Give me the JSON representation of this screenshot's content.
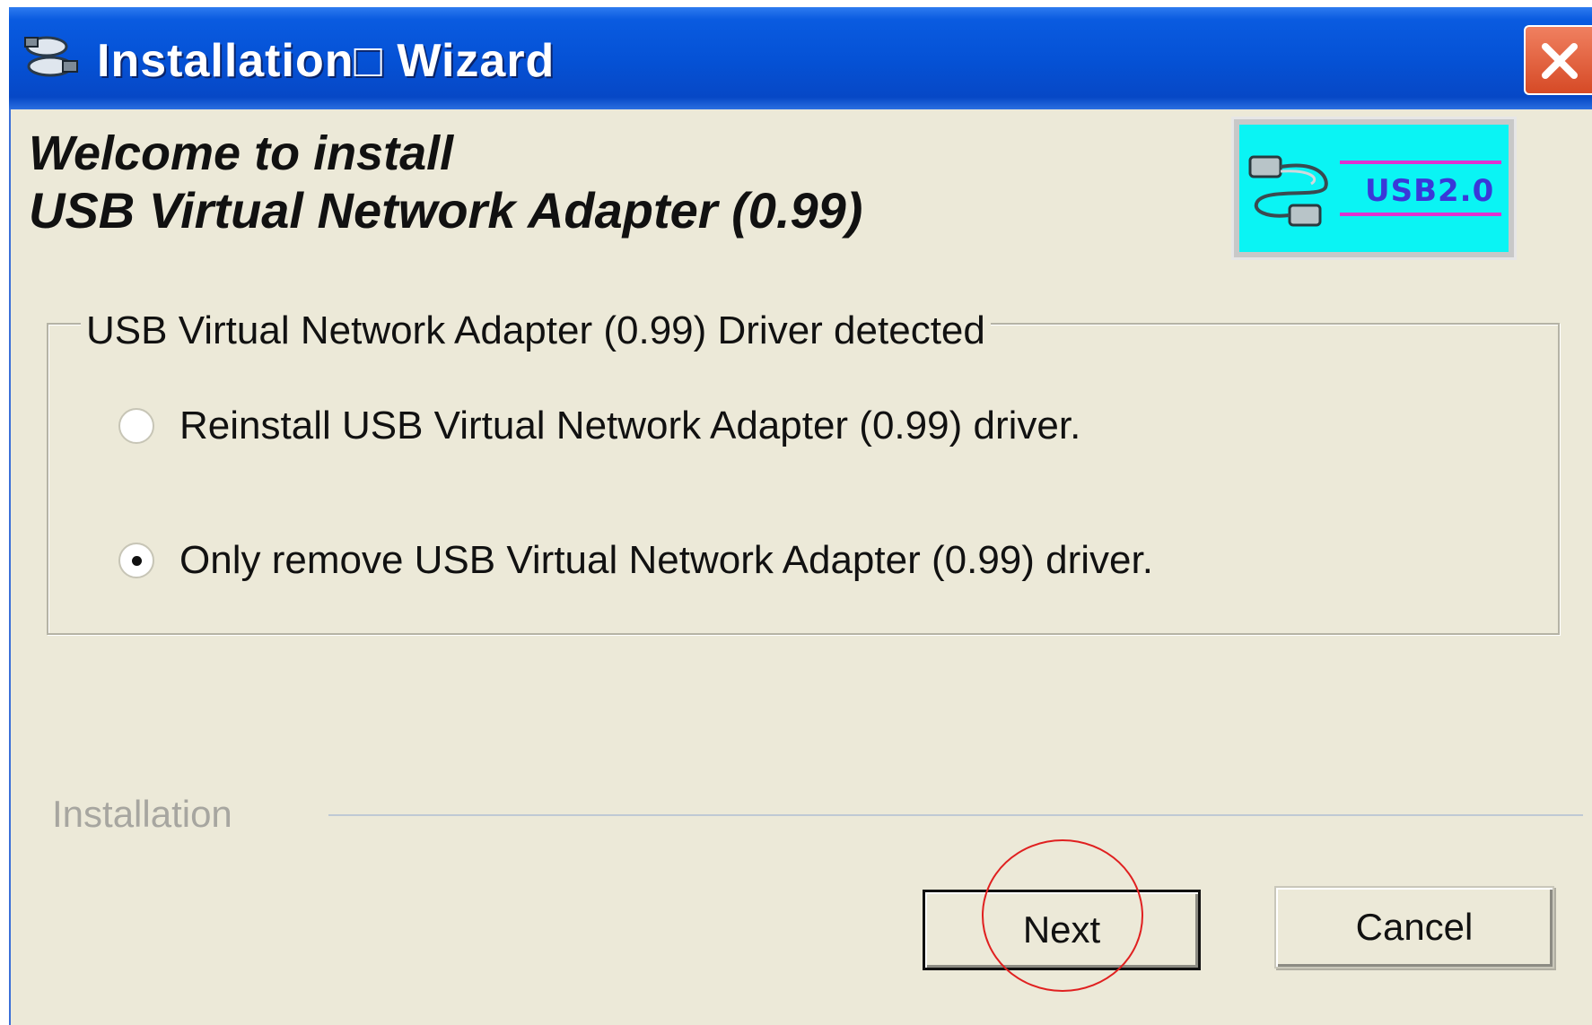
{
  "window": {
    "title": "Installation□ Wizard",
    "icon": "network-cable-icon",
    "close_icon": "close-icon"
  },
  "header": {
    "line1": "Welcome to install",
    "line2": "USB Virtual Network Adapter (0.99)",
    "logo_text": "USB2.0"
  },
  "group": {
    "legend": "USB Virtual Network Adapter (0.99) Driver detected",
    "options": [
      {
        "label": "Reinstall USB Virtual Network Adapter (0.99) driver.",
        "selected": false
      },
      {
        "label": "Only remove USB Virtual Network Adapter (0.99) driver.",
        "selected": true
      }
    ]
  },
  "footer": {
    "section_label": "Installation",
    "next_label": "Next",
    "cancel_label": "Cancel"
  },
  "colors": {
    "titlebar": "#0552d6",
    "dialog_bg": "#ece9d8",
    "close": "#d64a26",
    "logo_bg": "#0af4f4",
    "annotation": "#e02020"
  }
}
